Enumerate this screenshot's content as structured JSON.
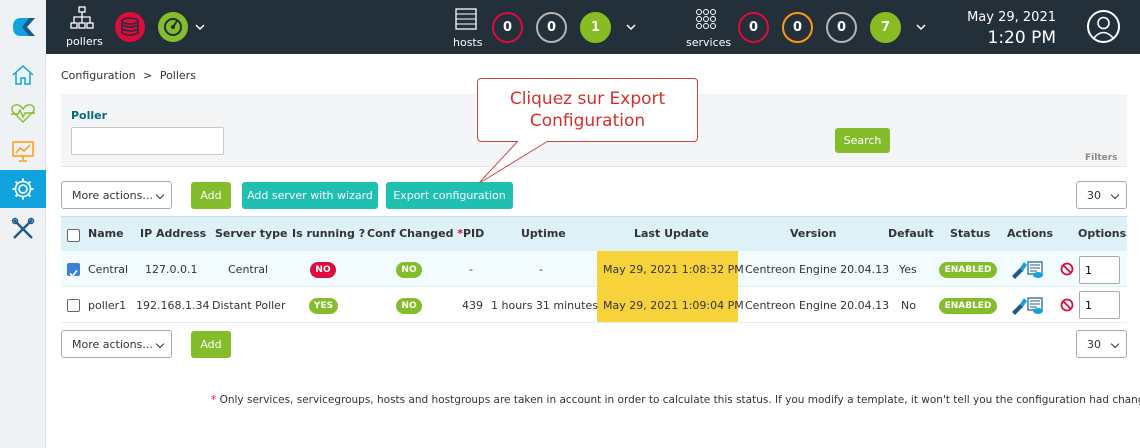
{
  "topbar": {
    "pollers_label": "pollers",
    "hosts_label": "hosts",
    "services_label": "services",
    "hosts_counts": [
      "0",
      "0",
      "1"
    ],
    "services_counts": [
      "0",
      "0",
      "0",
      "7"
    ],
    "date": "May 29, 2021",
    "time": "1:20 PM"
  },
  "breadcrumb": {
    "part1": "Configuration",
    "sep": ">",
    "part2": "Pollers"
  },
  "filter": {
    "label": "Poller",
    "input_value": "",
    "search_label": "Search",
    "filters_label": "Filters"
  },
  "callout": {
    "line1": "Cliquez sur Export",
    "line2": "Configuration"
  },
  "toolbar": {
    "more_actions": "More actions...",
    "add_label": "Add",
    "add_wizard_label": "Add server with wizard",
    "export_label": "Export configuration",
    "page_size": "30"
  },
  "table": {
    "headers": {
      "name": "Name",
      "ip": "IP Address",
      "server_type": "Server type",
      "is_running": "Is running ?",
      "conf_changed": "Conf Changed",
      "conf_star": "*",
      "pid": "PID",
      "uptime": "Uptime",
      "last_update": "Last Update",
      "version": "Version",
      "default": "Default",
      "status": "Status",
      "actions": "Actions",
      "options": "Options"
    },
    "rows": [
      {
        "checked": true,
        "name": "Central",
        "ip": "127.0.0.1",
        "server_type": "Central",
        "is_running": "NO",
        "conf_changed": "NO",
        "pid": "-",
        "uptime": "-",
        "last_update": "May 29, 2021 1:08:32 PM",
        "version": "Centreon Engine 20.04.13",
        "default": "Yes",
        "status": "ENABLED",
        "option_value": "1"
      },
      {
        "checked": false,
        "name": "poller1",
        "ip": "192.168.1.34",
        "server_type": "Distant Poller",
        "is_running": "YES",
        "conf_changed": "NO",
        "pid": "439",
        "uptime": "1 hours 31 minutes",
        "last_update": "May 29, 2021 1:09:04 PM",
        "version": "Centreon Engine 20.04.13",
        "default": "No",
        "status": "ENABLED",
        "option_value": "1"
      }
    ]
  },
  "footnote": {
    "star": "*",
    "text": " Only services, servicegroups, hosts and hostgroups are taken in account in order to calculate this status. If you modify a template, it won't tell you the configuration had changed."
  },
  "colors": {
    "topbar_bg": "#232f39",
    "accent_blue": "#10a3e0",
    "green": "#84bd2b",
    "teal": "#1fbfb1",
    "red": "#e00b3d",
    "orange": "#ff9913",
    "highlight_yellow": "#f7d23a"
  }
}
